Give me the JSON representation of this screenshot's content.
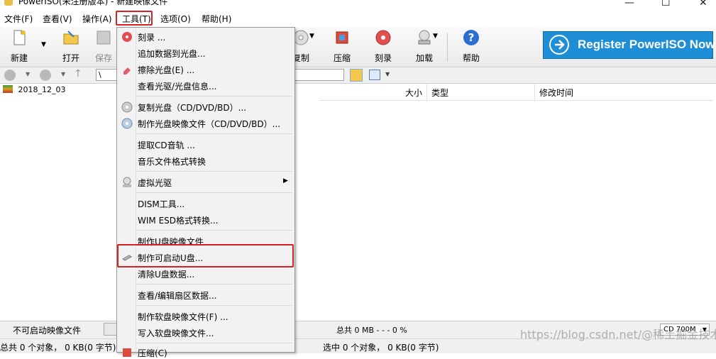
{
  "window": {
    "title": "PowerISO(未注册版本) - 新建映像文件"
  },
  "menubar": {
    "items": [
      {
        "label": "文件(F)"
      },
      {
        "label": "查看(V)"
      },
      {
        "label": "操作(A)"
      },
      {
        "label": "工具(T)"
      },
      {
        "label": "选项(O)"
      },
      {
        "label": "帮助(H)"
      }
    ]
  },
  "toolbar": {
    "new_label": "新建",
    "open_label": "打开",
    "save_label": "保存",
    "copy_label": "复制",
    "compress_label": "压缩",
    "burn_label": "刻录",
    "mount_label": "加载",
    "help_label": "帮助",
    "register_label": "Register PowerISO Now"
  },
  "address": {
    "path": "\\"
  },
  "tree": {
    "item_label": "2018_12_03"
  },
  "list": {
    "headers": {
      "size": "大小",
      "type": "类型",
      "modified": "修改时间"
    }
  },
  "dropdown": {
    "items": [
      "刻录 ...",
      "追加数据到光盘...",
      "擦除光盘(E) ...",
      "查看光驱/光盘信息...",
      "复制光盘（CD/DVD/BD）...",
      "制作光盘映像文件（CD/DVD/BD）...",
      "提取CD音轨 ...",
      "音乐文件格式转换",
      "虚拟光驱",
      "DISM工具...",
      "WIM ESD格式转换...",
      "制作U盘映像文件",
      "制作可启动U盘...",
      "清除U盘数据...",
      "查看/编辑扇区数据...",
      "制作软盘映像文件(F) ...",
      "写入软盘映像文件...",
      "压缩(C)"
    ]
  },
  "status": {
    "image_type": "不可启动映像文件",
    "total": "总共 0 MB   - - -  0 %",
    "media": "CD 700M",
    "total_objects": "总共 0 个对象， 0 KB(0 字节)",
    "selected_objects": "选中 0 个对象， 0 KB(0 字节)"
  },
  "watermark": "https://blog.csdn.net/@稀土掘金技术社区"
}
